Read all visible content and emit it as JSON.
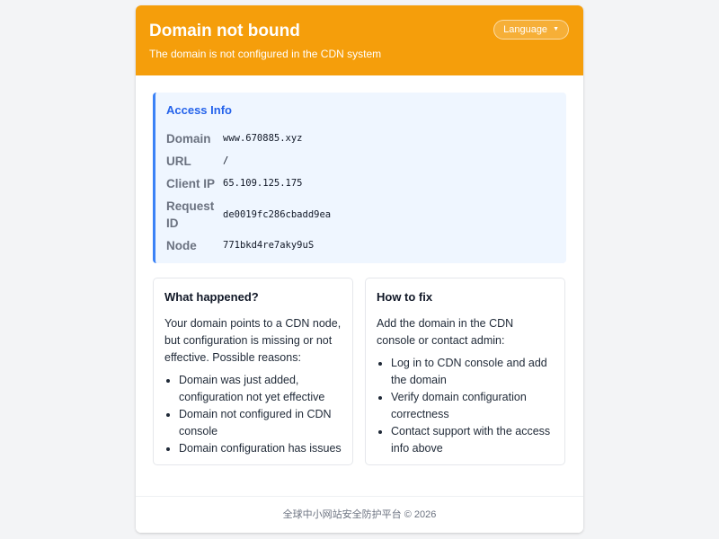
{
  "header": {
    "title": "Domain not bound",
    "subtitle": "The domain is not configured in the CDN system",
    "language_button": "Language",
    "accent_color": "#f59e0b"
  },
  "access_info": {
    "title": "Access Info",
    "rows": [
      {
        "label": "Domain",
        "value": "www.670885.xyz"
      },
      {
        "label": "URL",
        "value": "/"
      },
      {
        "label": "Client IP",
        "value": "65.109.125.175"
      },
      {
        "label": "Request ID",
        "value": "de0019fc286cbadd9ea"
      },
      {
        "label": "Node",
        "value": "771bkd4re7aky9uS"
      }
    ]
  },
  "what_happened": {
    "title": "What happened?",
    "text": "Your domain points to a CDN node, but configuration is missing or not effective. Possible reasons:",
    "items": [
      "Domain was just added, configuration not yet effective",
      "Domain not configured in CDN console",
      "Domain configuration has issues"
    ]
  },
  "how_to_fix": {
    "title": "How to fix",
    "text": "Add the domain in the CDN console or contact admin:",
    "items": [
      "Log in to CDN console and add the domain",
      "Verify domain configuration correctness",
      "Contact support with the access info above"
    ]
  },
  "footer": {
    "text": "全球中小网站安全防护平台 © 2026"
  }
}
